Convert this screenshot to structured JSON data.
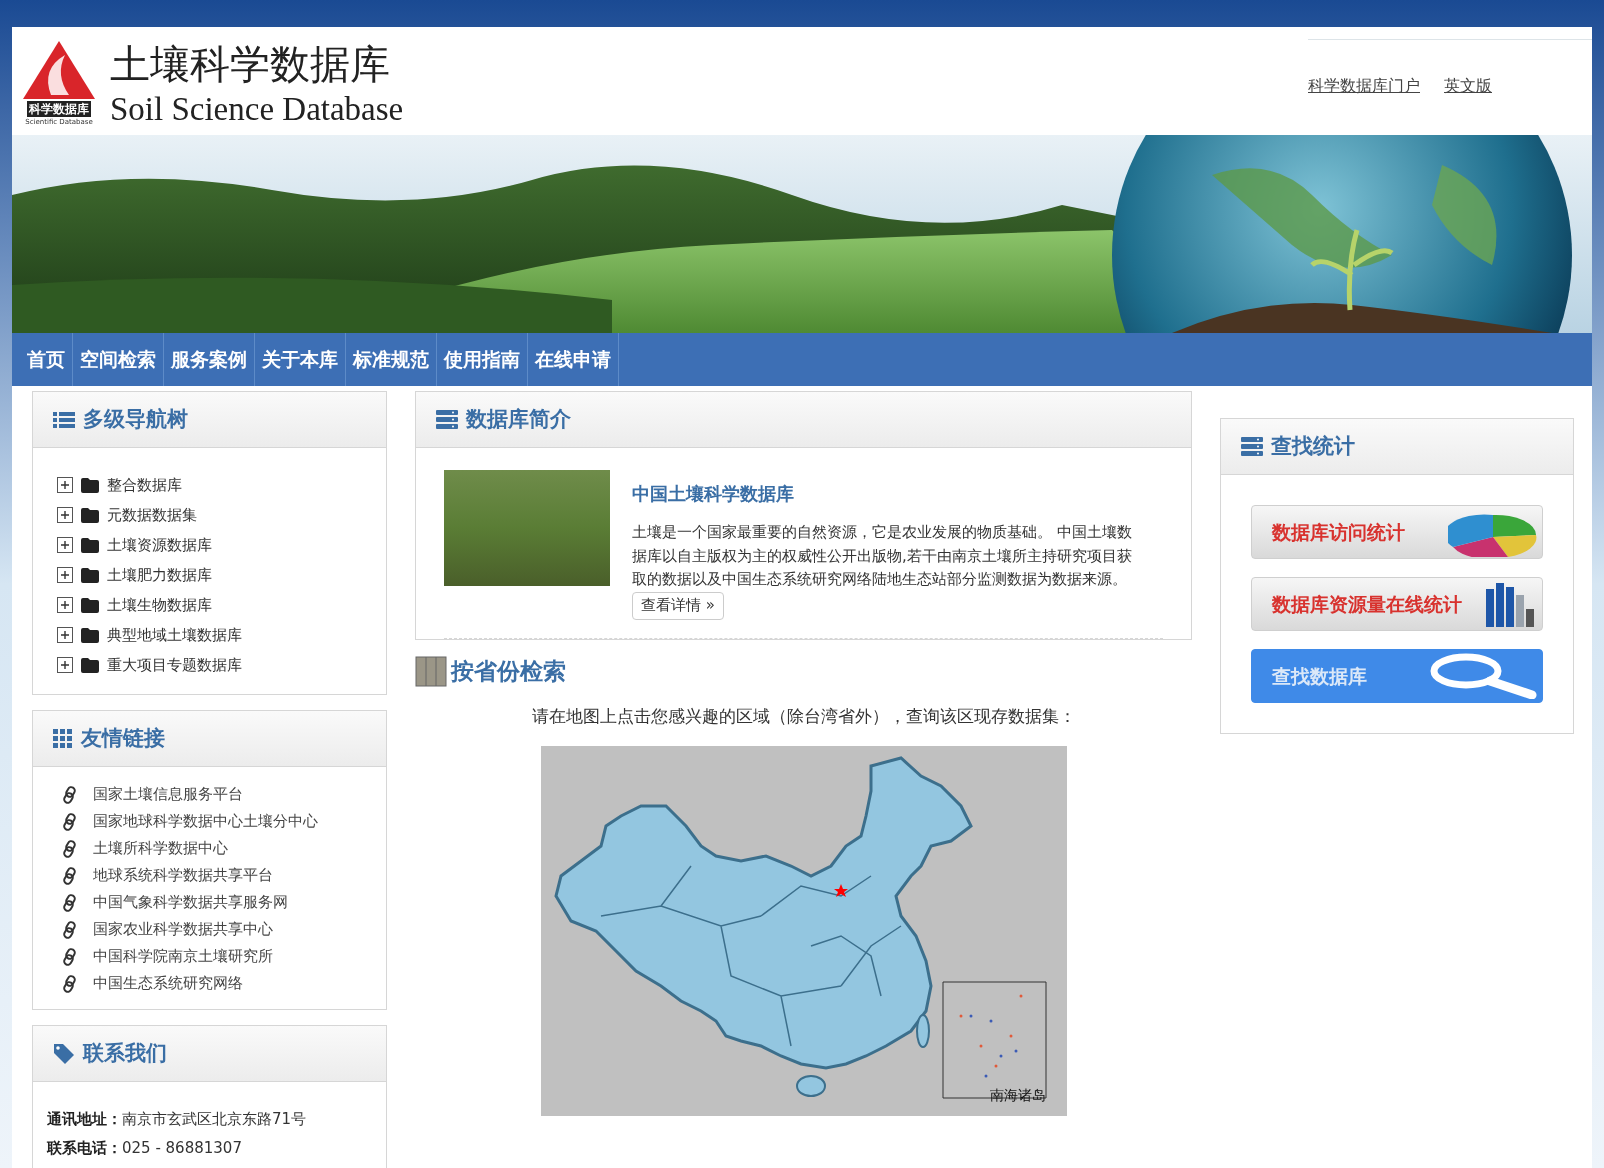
{
  "header": {
    "logo": {
      "badge": "科学数据库",
      "caption": "Scientific Database"
    },
    "title": "土壤科学数据库",
    "subtitle": "Soil Science Database",
    "links": [
      "科学数据库门户",
      "英文版"
    ]
  },
  "nav": [
    {
      "label": "首页"
    },
    {
      "label": "空间检索"
    },
    {
      "label": "服务案例"
    },
    {
      "label": "关于本库"
    },
    {
      "label": "标准规范"
    },
    {
      "label": "使用指南"
    },
    {
      "label": "在线申请"
    }
  ],
  "tree_panel": {
    "title": "多级导航树",
    "items": [
      {
        "label": "整合数据库",
        "expanded": false
      },
      {
        "label": "元数据数据集",
        "expanded": false
      },
      {
        "label": "土壤资源数据库",
        "expanded": false
      },
      {
        "label": "土壤肥力数据库",
        "expanded": false
      },
      {
        "label": "土壤生物数据库",
        "expanded": false
      },
      {
        "label": "典型地域土壤数据库",
        "expanded": false
      },
      {
        "label": "重大项目专题数据库",
        "expanded": false
      }
    ]
  },
  "links_panel": {
    "title": "友情链接",
    "items": [
      "国家土壤信息服务平台",
      "国家地球科学数据中心土壤分中心",
      "土壤所科学数据中心",
      "地球系统科学数据共享平台",
      "中国气象科学数据共享服务网",
      "国家农业科学数据共享中心",
      "中国科学院南京土壤研究所",
      "中国生态系统研究网络"
    ]
  },
  "contact_panel": {
    "title": "联系我们",
    "rows": [
      {
        "label": "通讯地址：",
        "value": "南京市玄武区北京东路71号"
      },
      {
        "label": "联系电话：",
        "value": "025 - 86881307"
      }
    ]
  },
  "intro_panel": {
    "title": "数据库简介",
    "heading": "中国土壤科学数据库",
    "text": "土壤是一个国家最重要的自然资源，它是农业发展的物质基础。 中国土壤数据库以自主版权为主的权威性公开出版物,若干由南京土壤所主持研究项目获取的数据以及中国生态系统研究网络陆地生态站部分监测数据为数据来源。",
    "more": "查看详情 »"
  },
  "province_search": {
    "title": "按省份检索",
    "instruction": "请在地图上点击您感兴趣的区域（除台湾省外），查询该区现存数据集：",
    "map_label": "南海诸岛"
  },
  "stats_panel": {
    "title": "查找统计",
    "buttons": [
      {
        "kind": "pie",
        "label": "数据库访问统计"
      },
      {
        "kind": "bars",
        "label": "数据库资源量在线统计"
      },
      {
        "kind": "search",
        "label": "查找数据库"
      }
    ]
  }
}
